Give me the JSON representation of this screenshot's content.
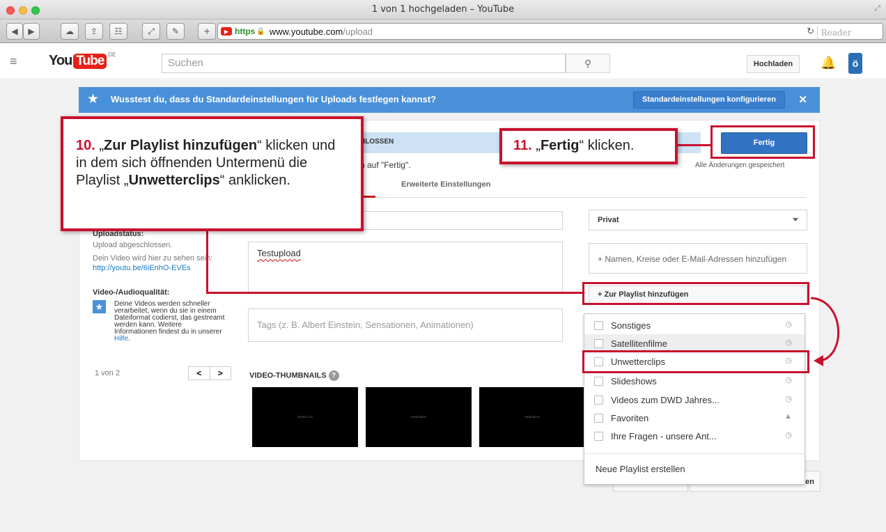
{
  "window": {
    "title": "1 von 1 hochgeladen – YouTube"
  },
  "browser": {
    "url_scheme": "https",
    "url_host": "www.youtube.com",
    "url_path": "/upload",
    "reader_label": "Reader"
  },
  "header": {
    "logo_you": "You",
    "logo_tube": "Tube",
    "logo_region": "DE",
    "search_placeholder": "Suchen",
    "upload_label": "Hochladen"
  },
  "banner": {
    "text": "Wusstest du, dass du Standardeinstellungen für Uploads festlegen kannst?",
    "configure_label": "Standardeinstellungen konfigurieren",
    "close": "✕"
  },
  "upload": {
    "status_strip_fragment": "HLOSSEN",
    "hint_fragment": "n auf \"Fertig\".",
    "saved_text": "Alle Änderungen gespeichert",
    "tab_advanced": "Erweiterte Einstellungen",
    "finish_label": "Fertig",
    "status_label": "Uploadstatus:",
    "status_value": "Upload abgeschlossen.",
    "video_here": "Dein Video wird hier zu sehen sein:",
    "video_link": "http://youtu.be/6iEnhO-EVEs",
    "quality_label": "Video-/Audioqualität:",
    "quality_text": "Deine Videos werden schneller verarbeitet, wenn du sie in einem Dateiformat codierst, das gestreamt werden kann. Weitere Informationen findest du in unserer",
    "quality_help": "Hilfe",
    "pager_count": "1 von 2",
    "pager_prev": "<",
    "pager_next": ">",
    "description_value": "Testupload",
    "tags_placeholder": "Tags (z. B. Albert Einstein, Sensationen, Animationen)",
    "thumbs_label": "VIDEO-THUMBNAILS",
    "thumbs": [
      "00:00:17.20",
      "00:00:35.00",
      "00:00:52.20"
    ],
    "privacy_value": "Privat",
    "share_placeholder": "+ Namen, Kreise oder E-Mail-Adressen hinzufügen",
    "add_playlist_label": "+ Zur Playlist hinzufügen",
    "bottom_btn_fragment": "en"
  },
  "playlists": {
    "items": [
      {
        "label": "Sonstiges",
        "icon": "globe-icon"
      },
      {
        "label": "Satellitenfilme",
        "icon": "globe-icon"
      },
      {
        "label": "Unwetterclips",
        "icon": "globe-icon"
      },
      {
        "label": "Slideshows",
        "icon": "globe-icon"
      },
      {
        "label": "Videos zum DWD Jahres...",
        "icon": "globe-icon"
      },
      {
        "label": "Favoriten",
        "icon": "lock-icon"
      },
      {
        "label": "Ihre Fragen - unsere Ant...",
        "icon": "globe-icon"
      }
    ],
    "new_label": "Neue Playlist erstellen"
  },
  "annotations": {
    "step10_num": "10.",
    "step10_q_open": "„",
    "step10_bold1": "Zur Playlist hinzufügen",
    "step10_q_close": "“",
    "step10_text": "klicken und in dem sich öffnenden Untermenü die Playlist",
    "step10_bold2": "Unwetterclips",
    "step10_end": "“ anklicken.",
    "step11_num": "11.",
    "step11_q_open": "„",
    "step11_bold": "Fertig",
    "step11_end": "“ klicken.",
    "accent_color": "#c8102e"
  }
}
